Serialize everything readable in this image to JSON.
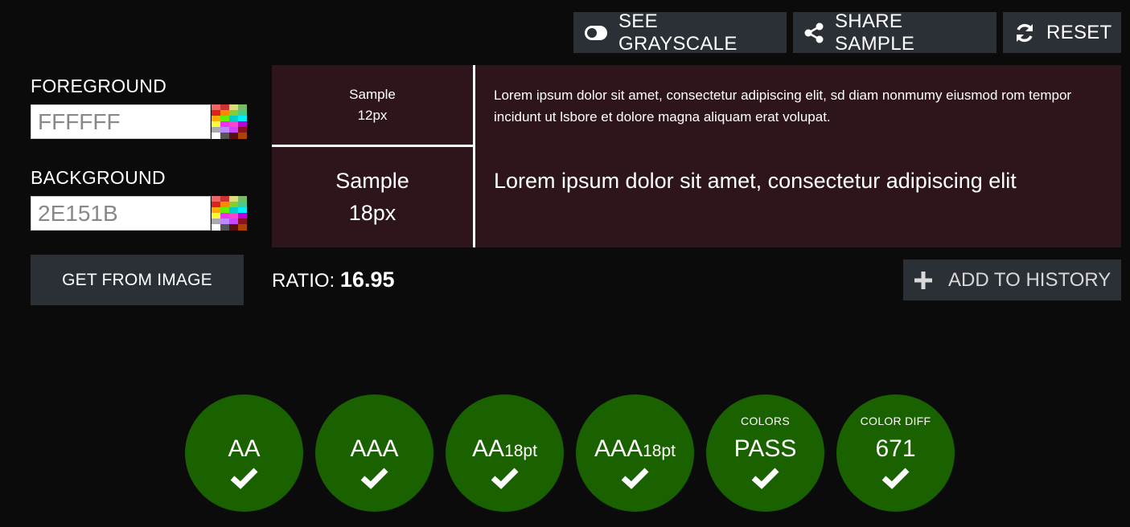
{
  "toolbar": {
    "grayscale_label": "SEE GRAYSCALE",
    "share_label": "SHARE SAMPLE",
    "reset_label": "RESET",
    "grayscale_icon": "toggle-icon",
    "share_icon": "share-icon",
    "reset_icon": "refresh-icon"
  },
  "foreground": {
    "label": "FOREGROUND",
    "value": "FFFFFF"
  },
  "background": {
    "label": "BACKGROUND",
    "value": "2E151B"
  },
  "get_from_image_label": "GET FROM IMAGE",
  "sample": {
    "small_label": "Sample",
    "small_size": "12px",
    "large_label": "Sample",
    "large_size": "18px",
    "small_text": "Lorem ipsum dolor sit amet, consectetur adipiscing elit, sd diam nonmumy eiusmod rom tempor incidunt ut lsbore et dolore magna aliquam erat volupat.",
    "large_text": "Lorem ipsum dolor sit amet, consectetur adipiscing elit"
  },
  "ratio": {
    "label": "RATIO:",
    "value": "16.95"
  },
  "add_history_label": "ADD TO HISTORY",
  "badges": [
    {
      "top": "",
      "main": "AA",
      "sub": "",
      "status": "pass"
    },
    {
      "top": "",
      "main": "AAA",
      "sub": "",
      "status": "pass"
    },
    {
      "top": "",
      "main": "AA",
      "sub": "18pt",
      "status": "pass"
    },
    {
      "top": "",
      "main": "AAA",
      "sub": "18pt",
      "status": "pass"
    },
    {
      "top": "COLORS",
      "main": "PASS",
      "sub": "",
      "status": "pass"
    },
    {
      "top": "COLOR DIFF",
      "main": "671",
      "sub": "",
      "status": "pass"
    }
  ],
  "colors": {
    "app_bg": "#0b0b0b",
    "foreground": "#FFFFFF",
    "background": "#2E151B",
    "button_bg": "#2b3036",
    "pass_green": "#1a6100"
  }
}
